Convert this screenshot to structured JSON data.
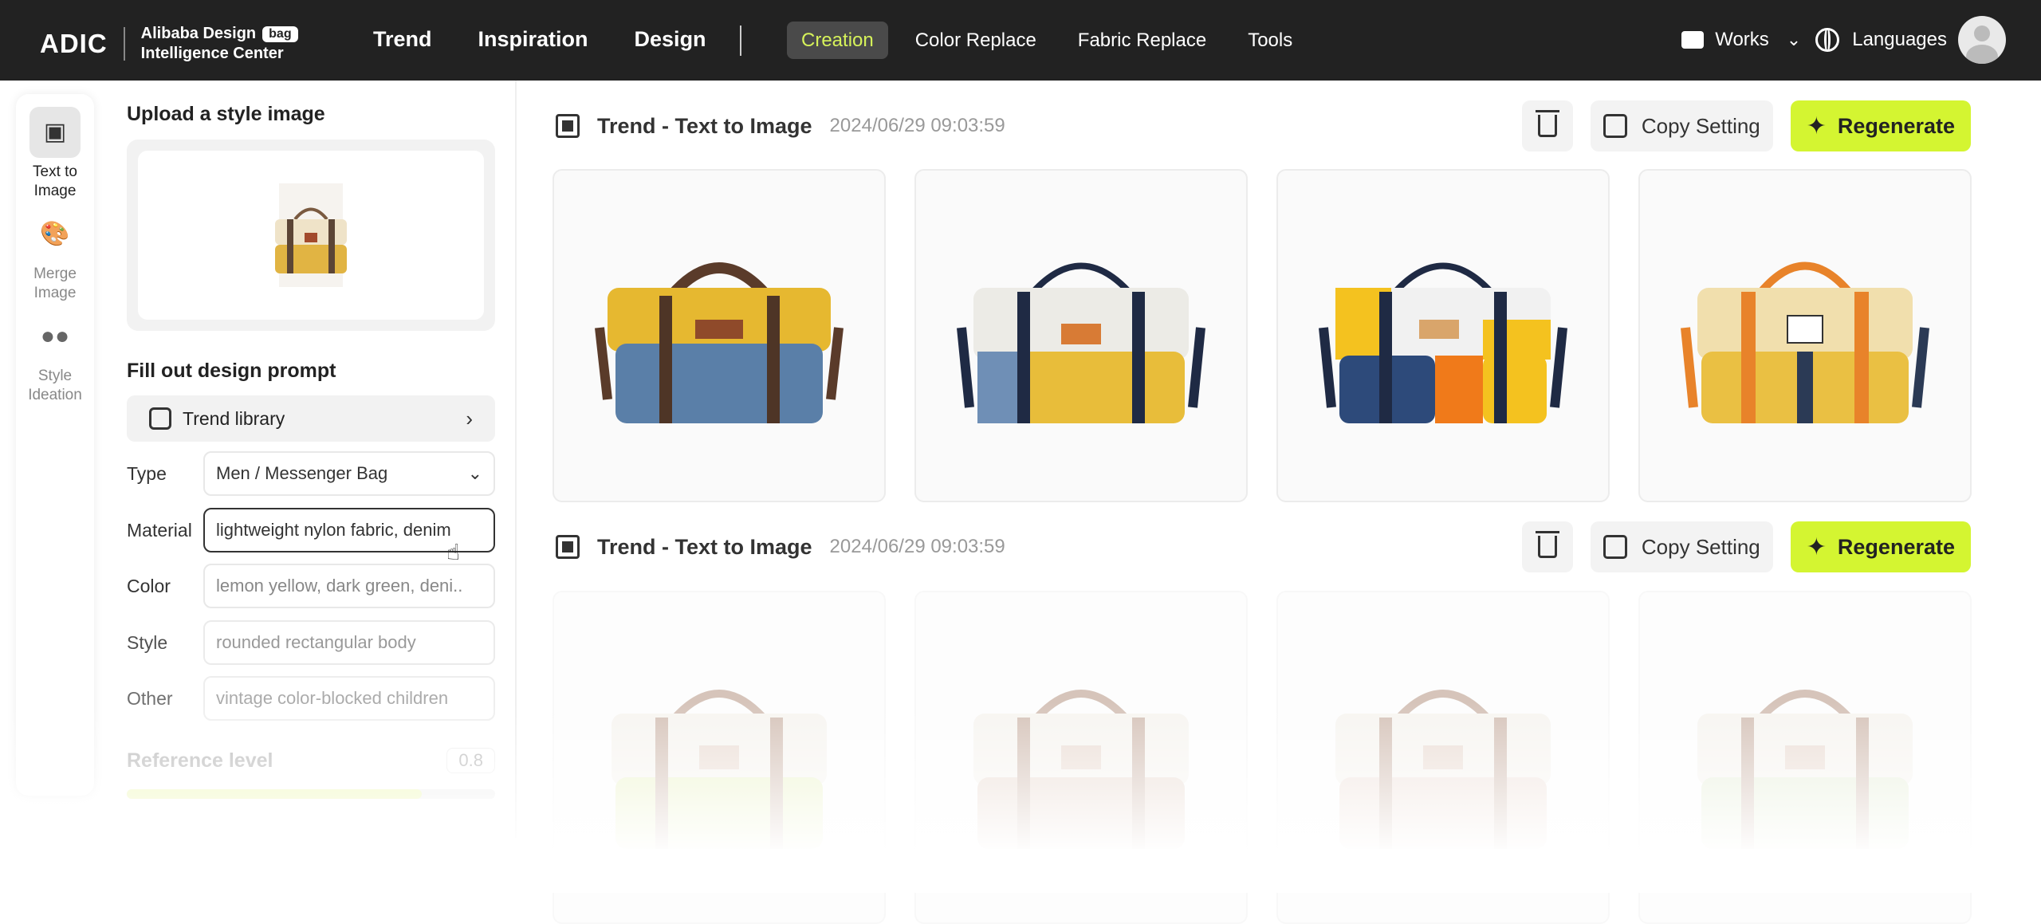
{
  "brand": {
    "mark": "ADIC",
    "line1": "Alibaba Design",
    "badge": "bag",
    "line2": "Intelligence Center"
  },
  "nav": {
    "main": [
      "Trend",
      "Inspiration",
      "Design"
    ],
    "sub": [
      {
        "label": "Creation",
        "active": true
      },
      {
        "label": "Color Replace",
        "active": false
      },
      {
        "label": "Fabric Replace",
        "active": false
      },
      {
        "label": "Tools",
        "active": false
      }
    ],
    "works": "Works",
    "languages": "Languages"
  },
  "rail": {
    "items": [
      {
        "label_1": "Text to",
        "label_2": "Image",
        "icon": "dice-icon",
        "active": true
      },
      {
        "label_1": "Merge",
        "label_2": "Image",
        "icon": "palette-icon",
        "active": false
      },
      {
        "label_1": "Style",
        "label_2": "Ideation",
        "icon": "people-icon",
        "active": false
      }
    ]
  },
  "form": {
    "upload_title": "Upload a style image",
    "prompt_title": "Fill out design prompt",
    "trend_library": "Trend library",
    "fields": {
      "type": {
        "label": "Type",
        "value": "Men / Messenger Bag"
      },
      "material": {
        "label": "Material",
        "value": "lightweight nylon fabric, denim"
      },
      "color": {
        "label": "Color",
        "value": "lemon yellow, dark green, deni.."
      },
      "style": {
        "label": "Style",
        "value": "rounded rectangular body"
      },
      "other": {
        "label": "Other",
        "value": "vintage color-blocked children"
      }
    },
    "reference_level": {
      "label": "Reference level",
      "value": "0.8"
    }
  },
  "results": [
    {
      "title": "Trend - Text to Image",
      "time": "2024/06/29 09:03:59",
      "copy_label": "Copy Setting",
      "regen_label": "Regenerate",
      "images": [
        "yellow-blue",
        "white-navy",
        "colorblock",
        "cream-orange"
      ]
    },
    {
      "title": "Trend - Text to Image",
      "time": "2024/06/29 09:03:59",
      "copy_label": "Copy Setting",
      "regen_label": "Regenerate",
      "images": [
        "faded-1",
        "faded-2",
        "faded-3",
        "faded-4"
      ]
    }
  ],
  "colors": {
    "accent": "#d4f531",
    "active_nav_text": "#d6f25a",
    "topbar": "#222222"
  }
}
